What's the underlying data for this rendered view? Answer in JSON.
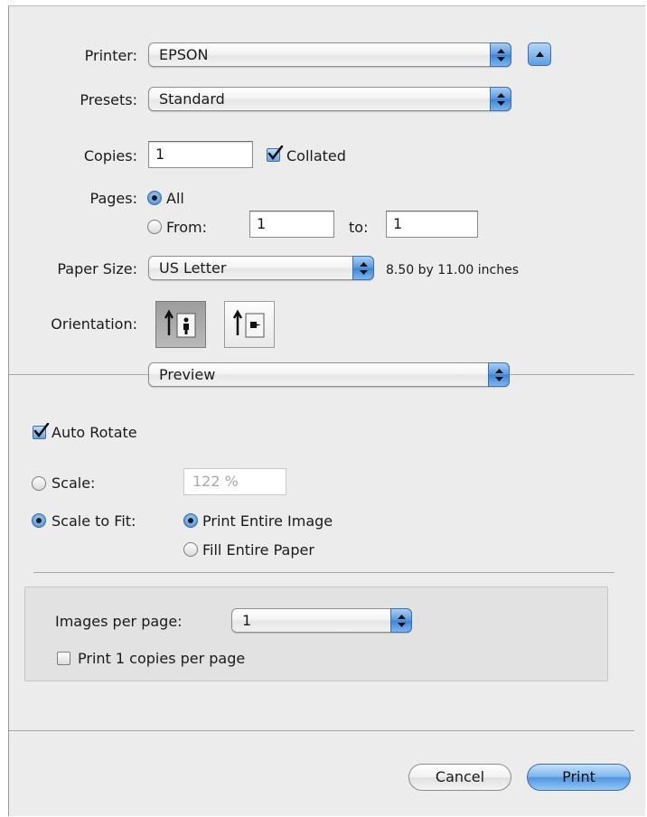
{
  "printer": {
    "label": "Printer:",
    "value": "EPSON"
  },
  "presets": {
    "label": "Presets:",
    "value": "Standard"
  },
  "copies": {
    "label": "Copies:",
    "value": "1",
    "collated_label": "Collated",
    "collated_checked": true
  },
  "pages": {
    "label": "Pages:",
    "all_label": "All",
    "from_label": "From:",
    "from_value": "1",
    "to_label": "to:",
    "to_value": "1"
  },
  "paper_size": {
    "label": "Paper Size:",
    "value": "US Letter",
    "dimensions": "8.50 by 11.00 inches"
  },
  "orientation": {
    "label": "Orientation:",
    "selected": "portrait"
  },
  "panel_menu": {
    "value": "Preview"
  },
  "auto_rotate": {
    "label": "Auto Rotate",
    "checked": true
  },
  "scale": {
    "label": "Scale:",
    "value": "122 %"
  },
  "scale_to_fit": {
    "label": "Scale to Fit:",
    "print_entire_label": "Print Entire Image",
    "fill_entire_label": "Fill Entire Paper"
  },
  "images_per_page": {
    "label": "Images per page:",
    "value": "1"
  },
  "print_copies_per_page": {
    "label": "Print 1 copies per page",
    "checked": false
  },
  "buttons": {
    "cancel": "Cancel",
    "print": "Print"
  },
  "colors": {
    "accent": "#4f95e0",
    "dialog_bg": "#ececec"
  }
}
